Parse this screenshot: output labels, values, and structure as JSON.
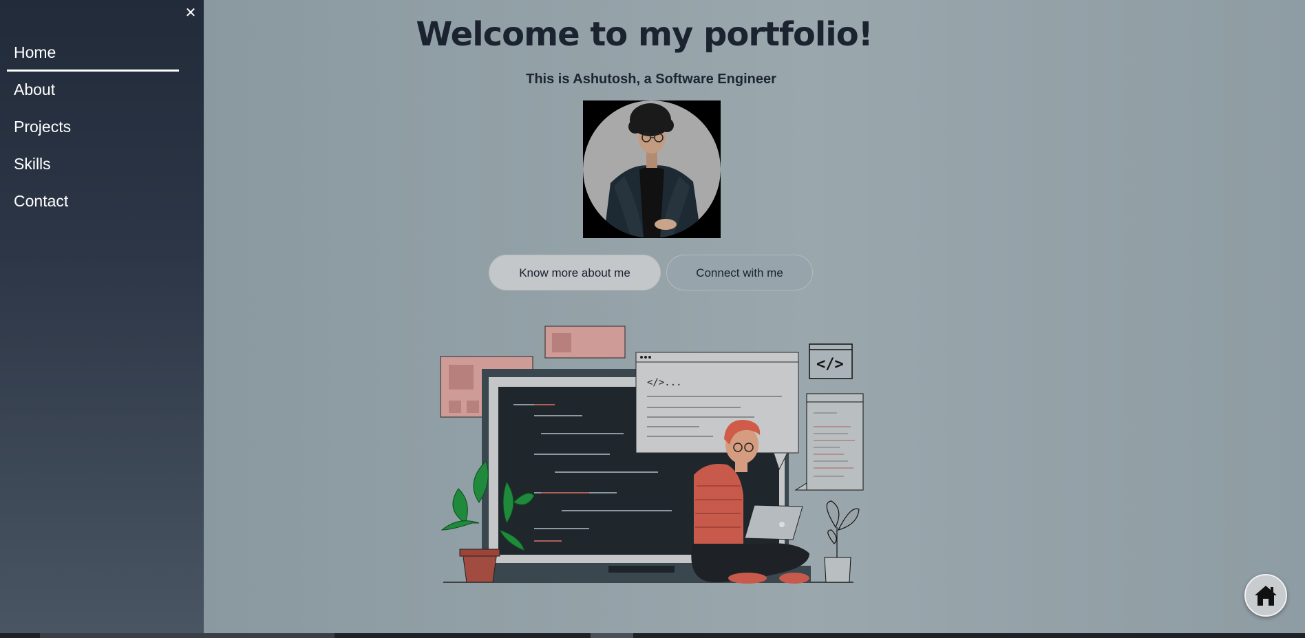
{
  "sidebar": {
    "close_icon": "close-icon",
    "close_glyph": "✕",
    "items": [
      {
        "label": "Home",
        "active": true
      },
      {
        "label": "About",
        "active": false
      },
      {
        "label": "Projects",
        "active": false
      },
      {
        "label": "Skills",
        "active": false
      },
      {
        "label": "Contact",
        "active": false
      }
    ]
  },
  "hero": {
    "title": "Welcome to my portfolio!",
    "subtitle": "This is Ashutosh, a Software Engineer",
    "primary_button": "Know more about me",
    "secondary_button": "Connect with me"
  },
  "illustration": {
    "code_tag": "</>...",
    "code_badge": "</>"
  },
  "home_button": {
    "icon": "home-icon"
  },
  "colors": {
    "sidebar_top": "#222b3a",
    "sidebar_bottom": "#4a5563",
    "main_bg": "#95a3a9",
    "title": "#1b2230",
    "accent_person": "#c85a4b"
  }
}
